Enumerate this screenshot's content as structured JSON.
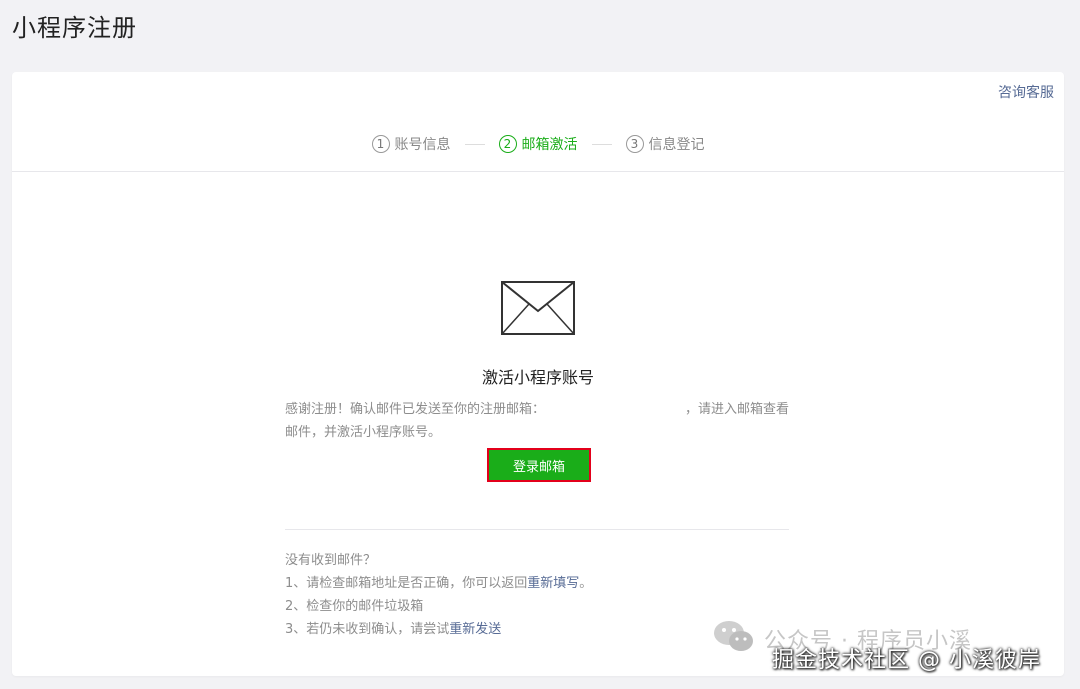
{
  "page_title": "小程序注册",
  "header": {
    "consult_label": "咨询客服"
  },
  "steps": [
    {
      "num": "1",
      "label": "账号信息"
    },
    {
      "num": "2",
      "label": "邮箱激活"
    },
    {
      "num": "3",
      "label": "信息登记"
    }
  ],
  "active_step": 2,
  "main": {
    "heading": "激活小程序账号",
    "desc_part1": "感谢注册！确认邮件已发送至你的注册邮箱：",
    "desc_part2": "，请进入邮箱查看邮件，并激活小程序账号。",
    "login_button": "登录邮箱"
  },
  "help": {
    "title": "没有收到邮件？",
    "item1_text": "1、请检查邮箱地址是否正确，你可以返回",
    "item1_link": "重新填写",
    "item1_end": "。",
    "item2_text": "2、检查你的邮件垃圾箱",
    "item3_text": "3、若仍未收到确认，请尝试",
    "item3_link": "重新发送"
  },
  "watermark": {
    "line1": "公众号 · 程序员小溪",
    "line2": "掘金技术社区 @ 小溪彼岸"
  },
  "colors": {
    "accent": "#1aad19",
    "link": "#576b95",
    "highlight_border": "#e3001b"
  }
}
